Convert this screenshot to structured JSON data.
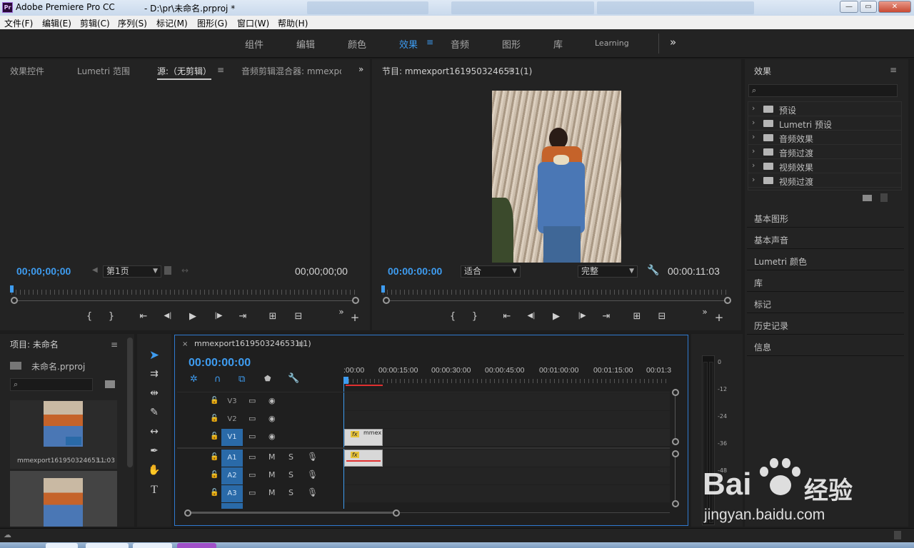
{
  "window": {
    "title": "Adobe Premiere Pro CC",
    "path": "- D:\\pr\\未命名.prproj *",
    "minimize": "—",
    "restore": "▭",
    "close": "✕"
  },
  "menu": [
    "文件(F)",
    "编辑(E)",
    "剪辑(C)",
    "序列(S)",
    "标记(M)",
    "图形(G)",
    "窗口(W)",
    "帮助(H)"
  ],
  "workspaces": [
    "组件",
    "编辑",
    "颜色",
    "效果",
    "音频",
    "图形",
    "库",
    "Learning"
  ],
  "workspace_active": "效果",
  "workspace_more": "»",
  "source_panel": {
    "tabs": [
      "效果控件",
      "Lumetri 范围",
      "源:（无剪辑）",
      "音频剪辑混合器: mmexpo"
    ],
    "timecode_in": "00;00;00;00",
    "page_select": "第1页",
    "timecode_out": "00;00;00;00"
  },
  "program_panel": {
    "title": "节目: mmexport1619503246531(1)",
    "timecode": "00:00:00:00",
    "fit": "适合",
    "quality": "完整",
    "duration": "00:00:11:03"
  },
  "transport": {
    "mark_in": "{",
    "mark_out": "}",
    "goto_in": "⇤",
    "step_back": "◀|",
    "play": "▶",
    "step_fwd": "|▶",
    "goto_out": "⇥",
    "insert": "⊞",
    "overwrite": "⊟",
    "more": "»",
    "add": "+"
  },
  "effects_panel": {
    "title": "效果",
    "search_placeholder": "",
    "items": [
      "预设",
      "Lumetri 预设",
      "音频效果",
      "音频过渡",
      "视频效果",
      "视频过渡"
    ],
    "side_panels": [
      "基本图形",
      "基本声音",
      "Lumetri 颜色",
      "库",
      "标记",
      "历史记录",
      "信息"
    ]
  },
  "project_panel": {
    "title": "项目: 未命名",
    "file": "未命名.prproj",
    "clip_name": "mmexport161950324653...",
    "clip_duration": "11:03"
  },
  "timeline": {
    "sequence": "mmexport1619503246531(1)",
    "close": "×",
    "timecode": "00:00:00:00",
    "ruler": [
      ":00:00",
      "00:00:15:00",
      "00:00:30:00",
      "00:00:45:00",
      "00:01:00:00",
      "00:01:15:00",
      "00:01:3"
    ],
    "tracks": [
      {
        "name": "V3",
        "type": "video",
        "target": false
      },
      {
        "name": "V2",
        "type": "video",
        "target": false
      },
      {
        "name": "V1",
        "type": "video",
        "target": true
      },
      {
        "name": "A1",
        "type": "audio",
        "target": true
      },
      {
        "name": "A2",
        "type": "audio",
        "target": true
      },
      {
        "name": "A3",
        "type": "audio",
        "target": true
      }
    ],
    "m_label": "M",
    "s_label": "S",
    "video_clip_label": "mmex",
    "fx_label": "fx"
  },
  "audio_meter": {
    "labels": [
      "0",
      "-12",
      "-24",
      "-36",
      "-48"
    ]
  },
  "watermark": {
    "brand": "Bai",
    "brand2": "经验",
    "url": "jingyan.baidu.com"
  },
  "colors": {
    "accent": "#3e9cf0",
    "track_target": "#2a6aa8",
    "playhead": "#3e9cf0"
  }
}
